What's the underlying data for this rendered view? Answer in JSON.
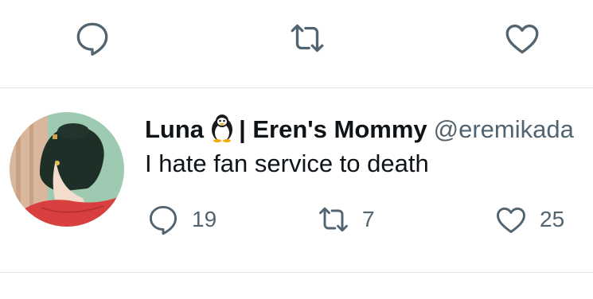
{
  "colors": {
    "text": "#0f1419",
    "muted": "#536471",
    "divider": "#e1e6ea",
    "icon": "#536471"
  },
  "previous_tweet_actions": {
    "reply_icon": "speech-bubble-icon",
    "retweet_icon": "retweet-arrows-icon",
    "like_icon": "heart-icon"
  },
  "tweet": {
    "display_name": "Luna",
    "emoji_icon": "penguin-icon",
    "name_suffix": "| Eren's Mommy",
    "handle": "@eremikada",
    "text": "I hate fan service to death",
    "replies": "19",
    "retweets": "7",
    "likes": "25"
  }
}
